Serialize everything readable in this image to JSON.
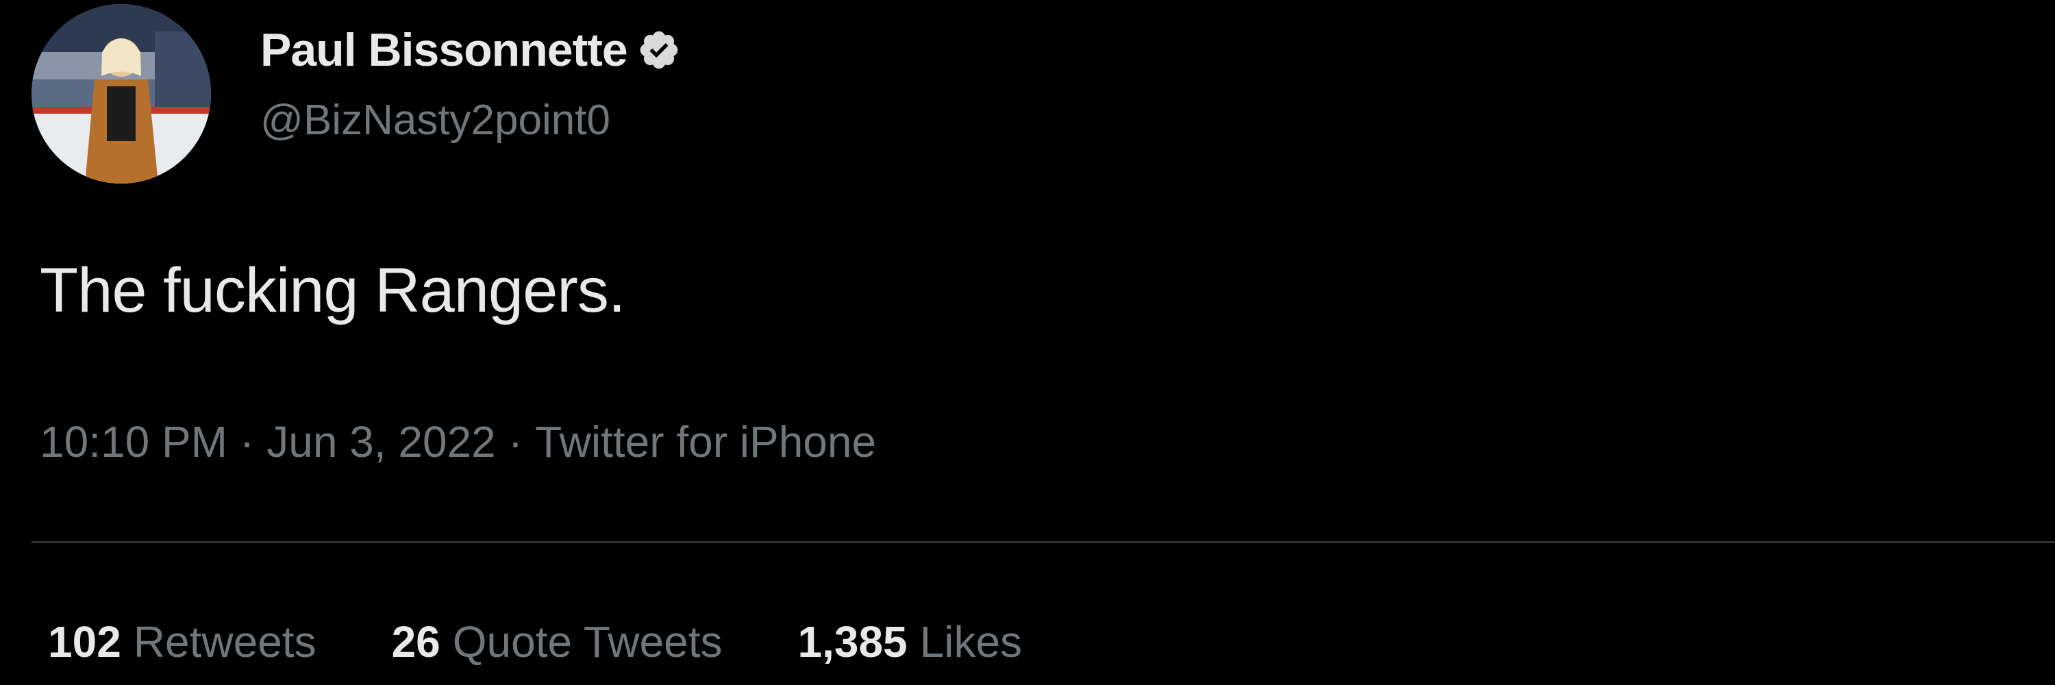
{
  "tweet": {
    "author": {
      "name": "Paul Bissonnette",
      "handle": "@BizNasty2point0",
      "verified": true
    },
    "text": "The fucking Rangers.",
    "meta": {
      "time": "10:10 PM",
      "separator": "·",
      "date": "Jun 3, 2022",
      "source": "Twitter for iPhone"
    },
    "stats": [
      {
        "count": "102",
        "label": "Retweets"
      },
      {
        "count": "26",
        "label": "Quote Tweets"
      },
      {
        "count": "1,385",
        "label": "Likes"
      }
    ]
  },
  "colors": {
    "background": "#000000",
    "primary_text": "#e7e9ea",
    "secondary_text": "#71767b",
    "divider": "#2f3336",
    "verified_badge": "#d9d9d9"
  },
  "icons": {
    "verified": "verified-badge-icon"
  }
}
